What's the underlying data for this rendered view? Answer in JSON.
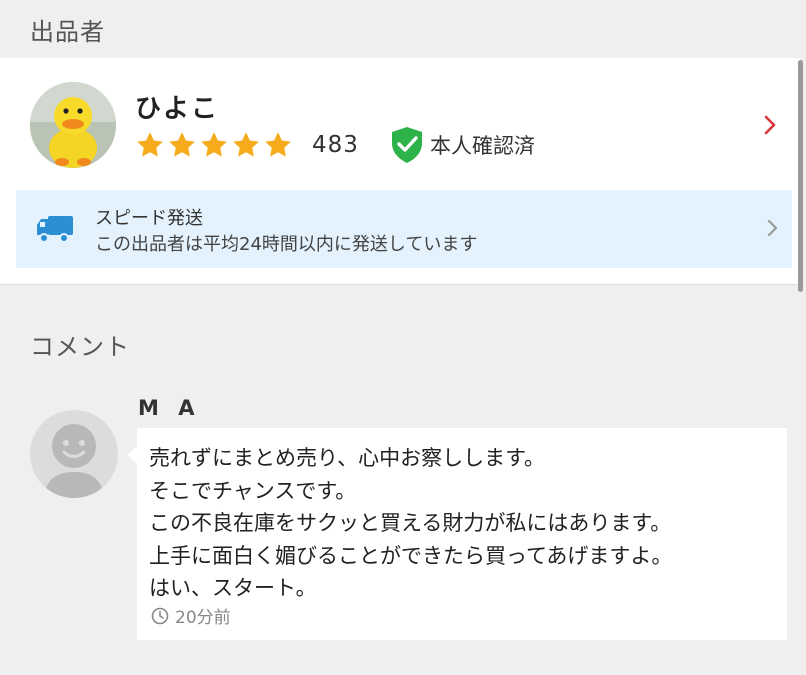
{
  "seller_section": {
    "label": "出品者",
    "seller": {
      "name": "ひよこ",
      "rating_stars": 5,
      "rating_max": 5,
      "rating_count": "483",
      "verified_label": "本人確認済"
    },
    "speed_shipping": {
      "title": "スピード発送",
      "description": "この出品者は平均24時間以内に発送しています"
    }
  },
  "comment_section": {
    "label": "コメント",
    "comments": [
      {
        "author": "M A",
        "lines": [
          "売れずにまとめ売り、心中お察しします。",
          "そこでチャンスです。",
          "この不良在庫をサクッと買える財力が私にはあります。",
          "上手に面白く媚びることができたら買ってあげますよ。",
          "はい、スタート。"
        ],
        "time": "20分前"
      }
    ]
  },
  "icons": {
    "star": "star-icon",
    "verified": "shield-check-icon",
    "chevron": "chevron-right-icon",
    "truck": "truck-icon",
    "clock": "clock-icon",
    "default_avatar": "smiley-avatar-icon"
  },
  "colors": {
    "star": "#f6ab1d",
    "verified": "#2db34a",
    "chevron_active": "#d9383a",
    "truck": "#2c8fd6",
    "speed_banner_bg": "#e3f2fc"
  }
}
